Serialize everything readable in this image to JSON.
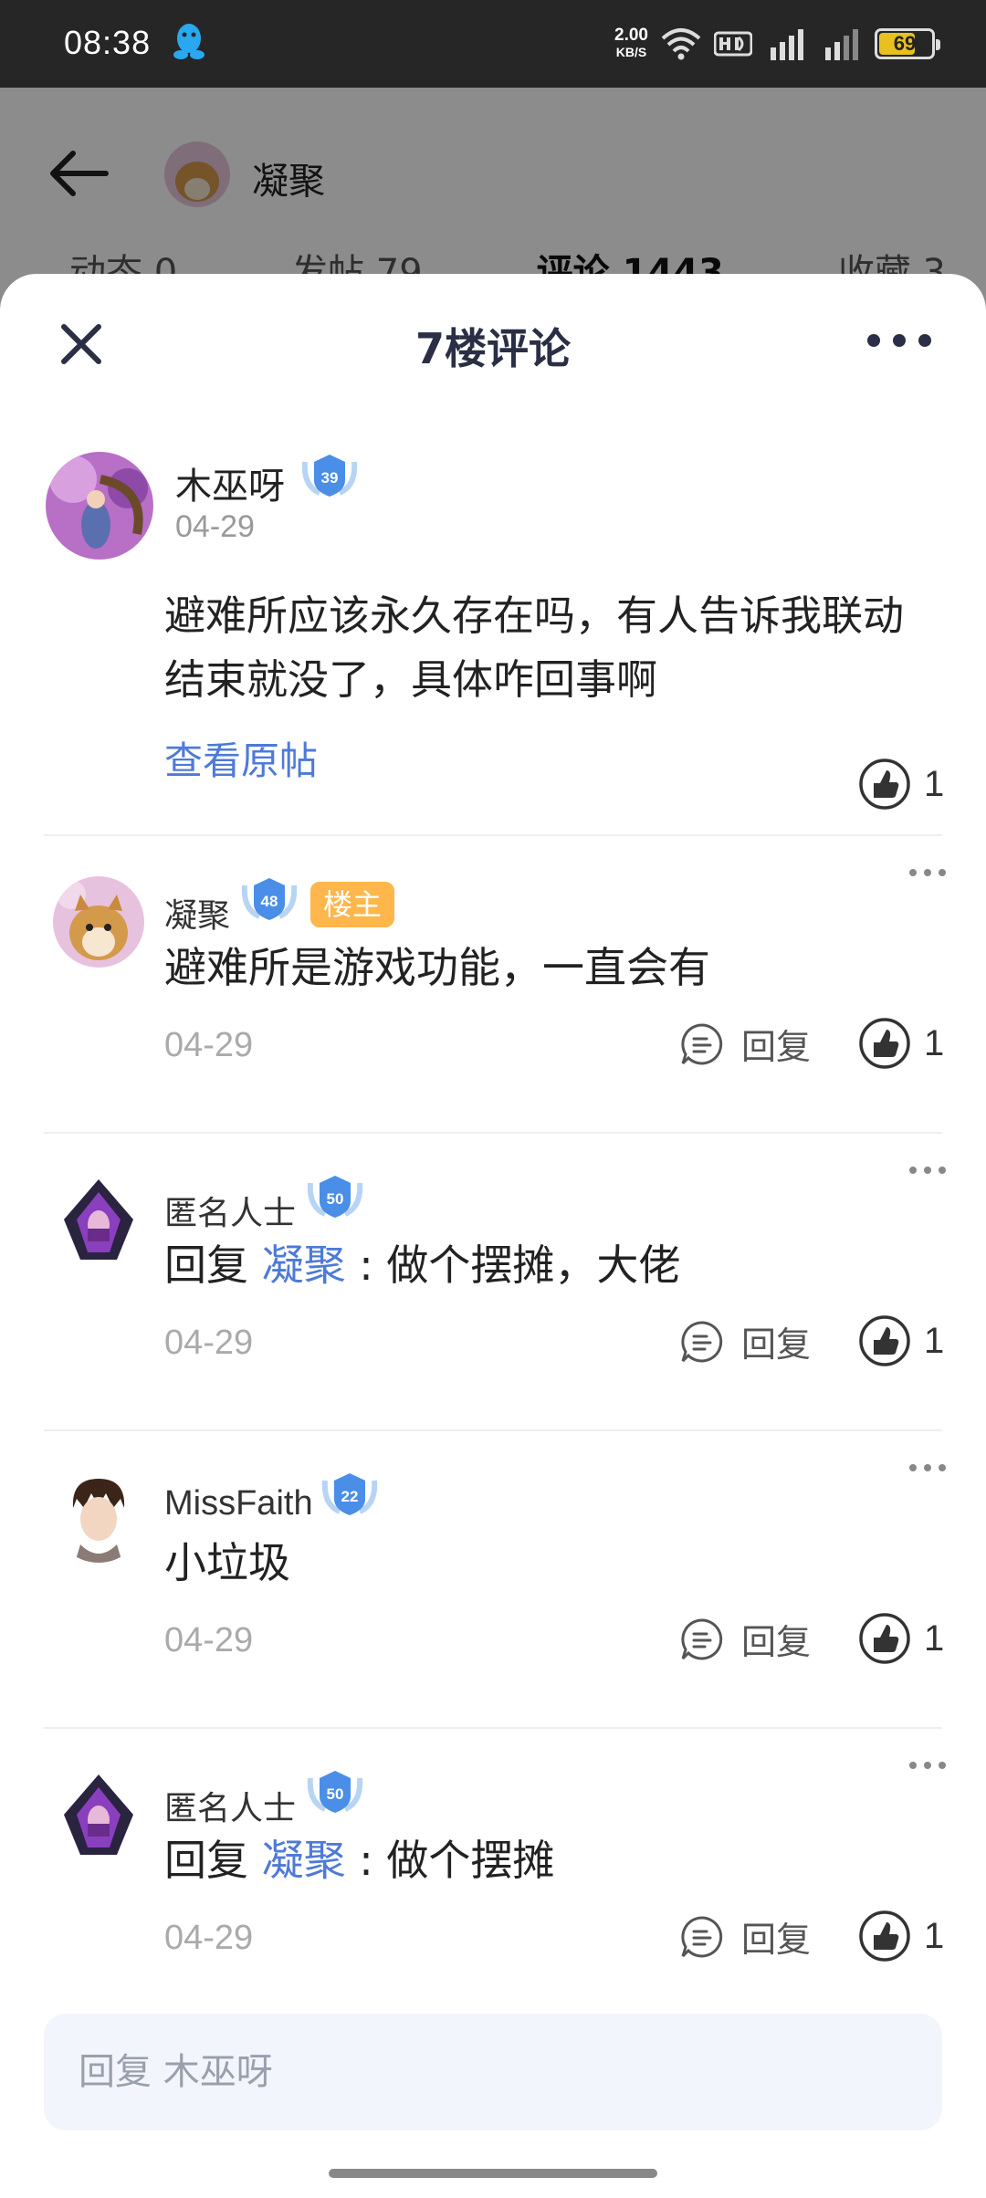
{
  "status_bar": {
    "time": "08:38",
    "net_speed": "2.00",
    "net_unit": "KB/S",
    "battery": "69",
    "battery_level": 0.69
  },
  "background_page": {
    "user_name": "凝聚",
    "tabs": [
      {
        "label": "动态 0"
      },
      {
        "label": "发帖 79"
      },
      {
        "label": "评论 1443"
      },
      {
        "label": "收藏 3"
      }
    ]
  },
  "sheet": {
    "title": "7楼评论"
  },
  "original_post": {
    "author": "木巫呀",
    "level": "39",
    "date": "04-29",
    "text": "避难所应该永久存在吗，有人告诉我联动结束就没了，具体咋回事啊",
    "view_original": "查看原帖",
    "likes": "1"
  },
  "comments": [
    {
      "author": "凝聚",
      "level": "48",
      "badge": "楼主",
      "reply_prefix": "",
      "reply_to": "",
      "text": "避难所是游戏功能，一直会有",
      "date": "04-29",
      "reply_label": "回复",
      "likes": "1"
    },
    {
      "author": "匿名人士",
      "level": "50",
      "badge": "",
      "reply_prefix": "回复 ",
      "reply_to": "凝聚",
      "text": " : 做个摆摊，大佬",
      "date": "04-29",
      "reply_label": "回复",
      "likes": "1"
    },
    {
      "author": "MissFaith",
      "level": "22",
      "badge": "",
      "reply_prefix": "",
      "reply_to": "",
      "text": "小垃圾",
      "date": "04-29",
      "reply_label": "回复",
      "likes": "1"
    },
    {
      "author": "匿名人士",
      "level": "50",
      "badge": "",
      "reply_prefix": "回复 ",
      "reply_to": "凝聚",
      "text": " : 做个摆摊",
      "date": "04-29",
      "reply_label": "回复",
      "likes": "1"
    }
  ],
  "reply_input": {
    "placeholder": "回复 木巫呀"
  },
  "colors": {
    "accent_link": "#4e7ad8",
    "host_badge": "#ffb64a",
    "title": "#2b2f45",
    "level_badge": "#4a8ee8"
  }
}
